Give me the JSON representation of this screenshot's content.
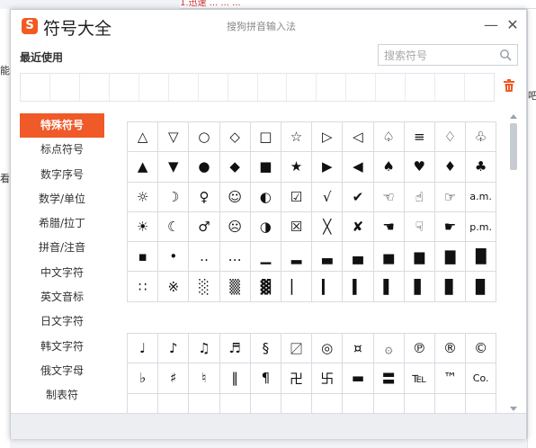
{
  "background": {
    "top_text": "1.迅速  ...  ...  ...",
    "left_chars": [
      "能",
      "看"
    ],
    "right_char": "吧"
  },
  "window": {
    "title": "符号大全",
    "subtitle": "搜狗拼音输入法",
    "logo_letter": "S",
    "minimize_label": "—",
    "close_label": "✕"
  },
  "recent": {
    "label": "最近使用",
    "cell_count": 16
  },
  "search": {
    "placeholder": "搜索符号",
    "value": ""
  },
  "colors": {
    "accent": "#ef5a28",
    "trash": "#ee5a24"
  },
  "categories": [
    {
      "label": "特殊符号",
      "active": true
    },
    {
      "label": "标点符号",
      "active": false
    },
    {
      "label": "数字序号",
      "active": false
    },
    {
      "label": "数学/单位",
      "active": false
    },
    {
      "label": "希腊/拉丁",
      "active": false
    },
    {
      "label": "拼音/注音",
      "active": false
    },
    {
      "label": "中文字符",
      "active": false
    },
    {
      "label": "英文音标",
      "active": false
    },
    {
      "label": "日文字符",
      "active": false
    },
    {
      "label": "韩文字符",
      "active": false
    },
    {
      "label": "俄文字母",
      "active": false
    },
    {
      "label": "制表符",
      "active": false
    }
  ],
  "grid1": [
    [
      "△",
      "▽",
      "○",
      "◇",
      "□",
      "☆",
      "▷",
      "◁",
      "♤",
      "≡",
      "♢",
      "♧"
    ],
    [
      "▲",
      "▼",
      "●",
      "◆",
      "■",
      "★",
      "▶",
      "◀",
      "♠",
      "♥",
      "♦",
      "♣"
    ],
    [
      "☼",
      "☽",
      "♀",
      "☺",
      "◐",
      "☑",
      "√",
      "✔",
      "☜",
      "☝",
      "☞",
      "a.m."
    ],
    [
      "☀",
      "☾",
      "♂",
      "☹",
      "◑",
      "☒",
      "╳",
      "✘",
      "☚",
      "☟",
      "☛",
      "p.m."
    ],
    [
      "▪",
      "•",
      "‥",
      "…",
      "▁",
      "▂",
      "▃",
      "▄",
      "▅",
      "▆",
      "▇",
      "█"
    ],
    [
      "∷",
      "※",
      "░",
      "▒",
      "▓",
      "▏",
      "▎",
      "▍",
      "▌",
      "▋",
      "▊",
      "▉"
    ]
  ],
  "grid2": [
    [
      "♩",
      "♪",
      "♫",
      "♬",
      "§",
      "〼",
      "◎",
      "¤",
      "۞",
      "℗",
      "®",
      "©"
    ],
    [
      "♭",
      "♯",
      "♮",
      "‖",
      "¶",
      "卍",
      "卐",
      "▬",
      "〓",
      "℡",
      "™",
      "Co."
    ],
    [
      "",
      "",
      "",
      "",
      "",
      "",
      "",
      "",
      "",
      "",
      "",
      ""
    ]
  ]
}
